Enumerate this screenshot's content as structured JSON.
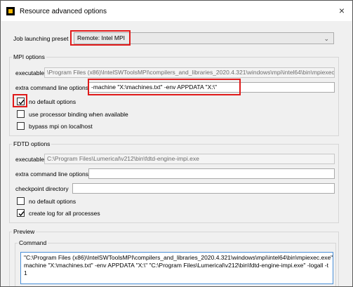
{
  "window": {
    "title": "Resource advanced options",
    "close_label": "×"
  },
  "job_preset": {
    "label": "Job launching preset",
    "value": "Remote: Intel MPI"
  },
  "mpi": {
    "group_title": "MPI options",
    "executable_label": "executable",
    "executable_value": "\\Program Files (x86)\\IntelSWToolsMPI\\compilers_and_libraries_2020.4.321\\windows\\mpi\\intel64\\bin\\mpiexec.exe",
    "extra_label": "extra command line options",
    "extra_value": "-machine \"X:\\machines.txt\" -env APPDATA \"X:\\\"",
    "no_default_label": "no default options",
    "no_default_checked": true,
    "binding_label": "use processor binding when available",
    "binding_checked": false,
    "bypass_label": "bypass mpi on localhost",
    "bypass_checked": false
  },
  "fdtd": {
    "group_title": "FDTD options",
    "executable_label": "executable",
    "executable_value": "C:\\Program Files\\Lumerical\\v212\\bin\\fdtd-engine-impi.exe",
    "extra_label": "extra command line options",
    "extra_value": "",
    "checkpoint_label": "checkpoint directory",
    "checkpoint_value": "",
    "no_default_label": "no default options",
    "no_default_checked": false,
    "log_label": "create log for all processes",
    "log_checked": true
  },
  "preview": {
    "group_title": "Preview",
    "command_title": "Command",
    "command_line1": "\"C:\\Program Files (x86)\\IntelSWToolsMPI\\compilers_and_libraries_2020.4.321\\windows\\mpi\\intel64\\bin\\mpiexec.exe\" -",
    "command_line2": "machine \"X:\\machines.txt\" -env APPDATA \"X:\\\" \"C:\\Program Files\\Lumerical\\v212\\bin\\fdtd-engine-impi.exe\" -logall -t",
    "command_line3": "1"
  },
  "colors": {
    "highlight": "#e01a1a",
    "command_border": "#4a90d9"
  }
}
